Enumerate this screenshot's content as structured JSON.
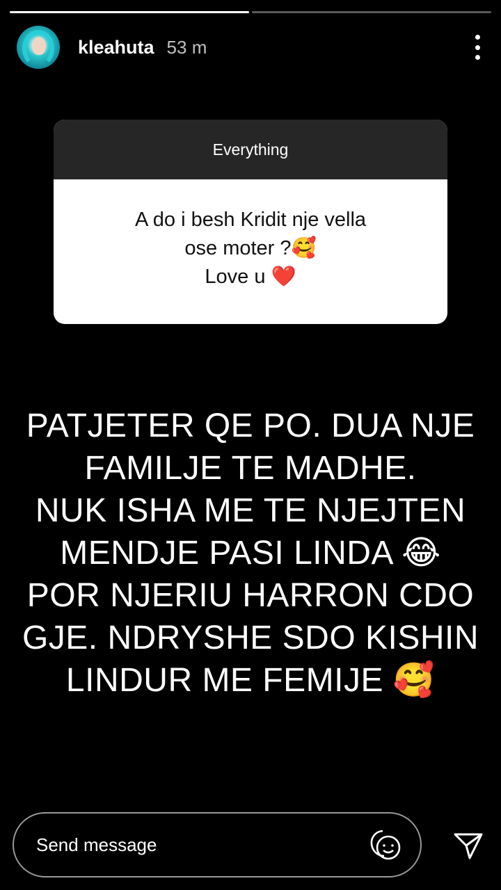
{
  "story": {
    "segments_total": 2,
    "segments_done": 1,
    "username": "kleahuta",
    "time": "53 m"
  },
  "question": {
    "header": "Everything",
    "line1": "A do i besh Kridit nje vella",
    "line2": "ose moter ?🥰",
    "line3": "Love u ❤️"
  },
  "answer": {
    "line1": "PATJETER QE PO. DUA NJE",
    "line2": "FAMILJE TE MADHE.",
    "line3": "NUK ISHA ME TE NJEJTEN",
    "line4": "MENDJE PASI LINDA 😂",
    "line5": "POR NJERIU HARRON CDO",
    "line6": "GJE. NDRYSHE SDO KISHIN",
    "line7": "LINDUR ME FEMIJE 🥰"
  },
  "composer": {
    "placeholder": "Send message"
  },
  "icons": {
    "more": "more-vertical-icon",
    "sticker": "sticker-smile-icon",
    "send": "send-paper-plane-icon"
  }
}
